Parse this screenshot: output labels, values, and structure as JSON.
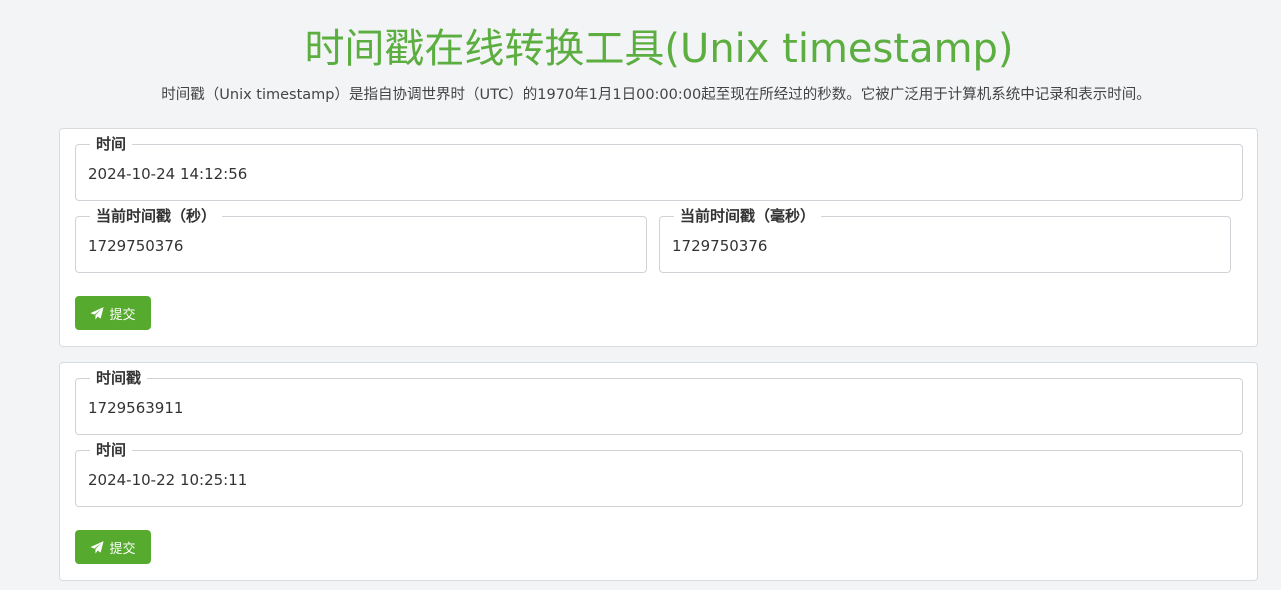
{
  "page": {
    "title": "时间戳在线转换工具(Unix timestamp)",
    "description": "时间戳（Unix timestamp）是指自协调世界时（UTC）的1970年1月1日00:00:00起至现在所经过的秒数。它被广泛用于计算机系统中记录和表示时间。"
  },
  "colors": {
    "accent": "#56ab2f",
    "title": "#5bae3f",
    "background": "#f3f4f6"
  },
  "datetime_to_timestamp": {
    "time_label": "时间",
    "time_value": "2024-10-24 14:12:56",
    "seconds_label": "当前时间戳（秒）",
    "seconds_value": "1729750376",
    "millis_label": "当前时间戳（毫秒）",
    "millis_value": "1729750376",
    "submit_label": "提交",
    "submit_icon": "paper-plane-icon"
  },
  "timestamp_to_datetime": {
    "timestamp_label": "时间戳",
    "timestamp_value": "1729563911",
    "time_label": "时间",
    "time_value": "2024-10-22 10:25:11",
    "submit_label": "提交",
    "submit_icon": "paper-plane-icon"
  }
}
